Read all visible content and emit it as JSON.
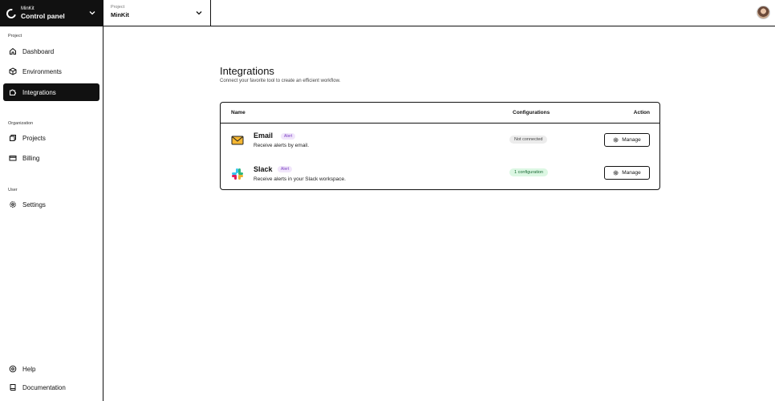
{
  "topbar": {
    "org_small": "MinKit",
    "org_big": "Control panel",
    "project_small": "Project",
    "project_big": "MinKit"
  },
  "sidebar": {
    "sections": [
      {
        "label": "Project"
      },
      {
        "label": "Organization"
      },
      {
        "label": "User"
      }
    ],
    "items": [
      {
        "label": "Dashboard",
        "icon": "home-icon"
      },
      {
        "label": "Environments",
        "icon": "box-icon"
      },
      {
        "label": "Integrations",
        "icon": "puzzle-icon",
        "active": true
      },
      {
        "label": "Projects",
        "icon": "copy-icon"
      },
      {
        "label": "Billing",
        "icon": "card-icon"
      },
      {
        "label": "Settings",
        "icon": "gear-icon"
      },
      {
        "label": "Help",
        "icon": "help-circle-icon"
      },
      {
        "label": "Documentation",
        "icon": "book-icon"
      }
    ]
  },
  "main": {
    "title": "Integrations",
    "subtitle": "Connect your favorite tool to create an efficient workflow.",
    "table": {
      "headers": {
        "name": "Name",
        "configurations": "Configurations",
        "action": "Action"
      },
      "rows": [
        {
          "name": "Email",
          "tag": "Alert",
          "description": "Receive alerts by email.",
          "status": "Not connected",
          "status_color": "#ececec",
          "action": "Manage",
          "icon": "envelope-icon"
        },
        {
          "name": "Slack",
          "tag": "Alert",
          "description": "Receive alerts in your Slack workspace.",
          "status": "1 configuration",
          "status_color": "#dcf7e3",
          "action": "Manage",
          "icon": "slack-icon"
        }
      ]
    }
  },
  "colors": {
    "accent": "#111111",
    "tag_text": "#7a3fc2",
    "tag_bg": "#f1e6fb"
  }
}
